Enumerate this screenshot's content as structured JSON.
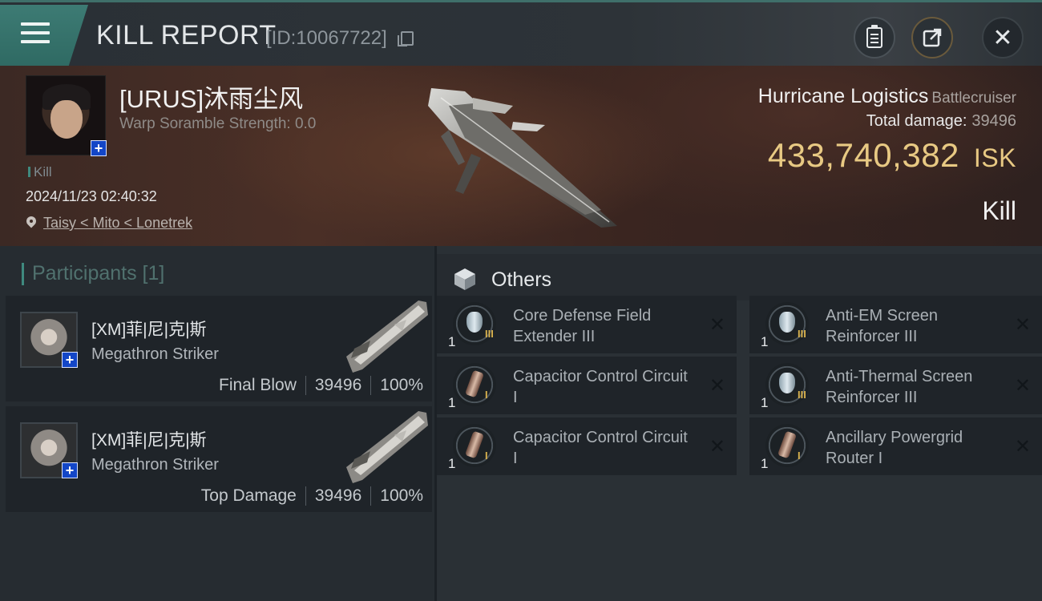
{
  "header": {
    "title": "KILL REPORT",
    "report_id": "[ID:10067722]",
    "close_glyph": "✕"
  },
  "victim": {
    "pilot_name": "[URUS]沐雨尘风",
    "warp_scramble": "Warp Soramble Strength: 0.0",
    "tag": "Kill",
    "datetime": "2024/11/23 02:40:32",
    "location": "Taisy < Mito < Lonetrek",
    "ship_name": "Hurricane Logistics",
    "ship_class": "Battlecruiser",
    "total_damage_label": "Total damage:",
    "total_damage_value": "39496",
    "isk_value": "433,740,382",
    "isk_unit": "ISK",
    "result_label": "Kill"
  },
  "participants": {
    "header": "Participants [1]",
    "rows": [
      {
        "name": "[XM]菲|尼|克|斯",
        "ship": "Megathron Striker",
        "role": "Final Blow",
        "damage": "39496",
        "percent": "100%"
      },
      {
        "name": "[XM]菲|尼|克|斯",
        "ship": "Megathron Striker",
        "role": "Top Damage",
        "damage": "39496",
        "percent": "100%"
      }
    ]
  },
  "others": {
    "header": "Others",
    "modules": [
      {
        "name": "Core Defense Field Extender III",
        "qty": "1",
        "tier": "III",
        "icon": "shield-module-icon"
      },
      {
        "name": "Anti-EM Screen Reinforcer III",
        "qty": "1",
        "tier": "III",
        "icon": "shield-module-icon"
      },
      {
        "name": "Capacitor Control Circuit I",
        "qty": "1",
        "tier": "I",
        "icon": "capacitor-module-icon"
      },
      {
        "name": "Anti-Thermal Screen Reinforcer III",
        "qty": "1",
        "tier": "III",
        "icon": "shield-module-icon"
      },
      {
        "name": "Capacitor Control Circuit I",
        "qty": "1",
        "tier": "I",
        "icon": "capacitor-module-icon"
      },
      {
        "name": "Ancillary Powergrid Router I",
        "qty": "1",
        "tier": "I",
        "icon": "capacitor-module-icon"
      }
    ],
    "remove_glyph": "✕"
  },
  "colors": {
    "accent_teal": "#3f8a7f",
    "isk_gold": "#e8c983"
  }
}
